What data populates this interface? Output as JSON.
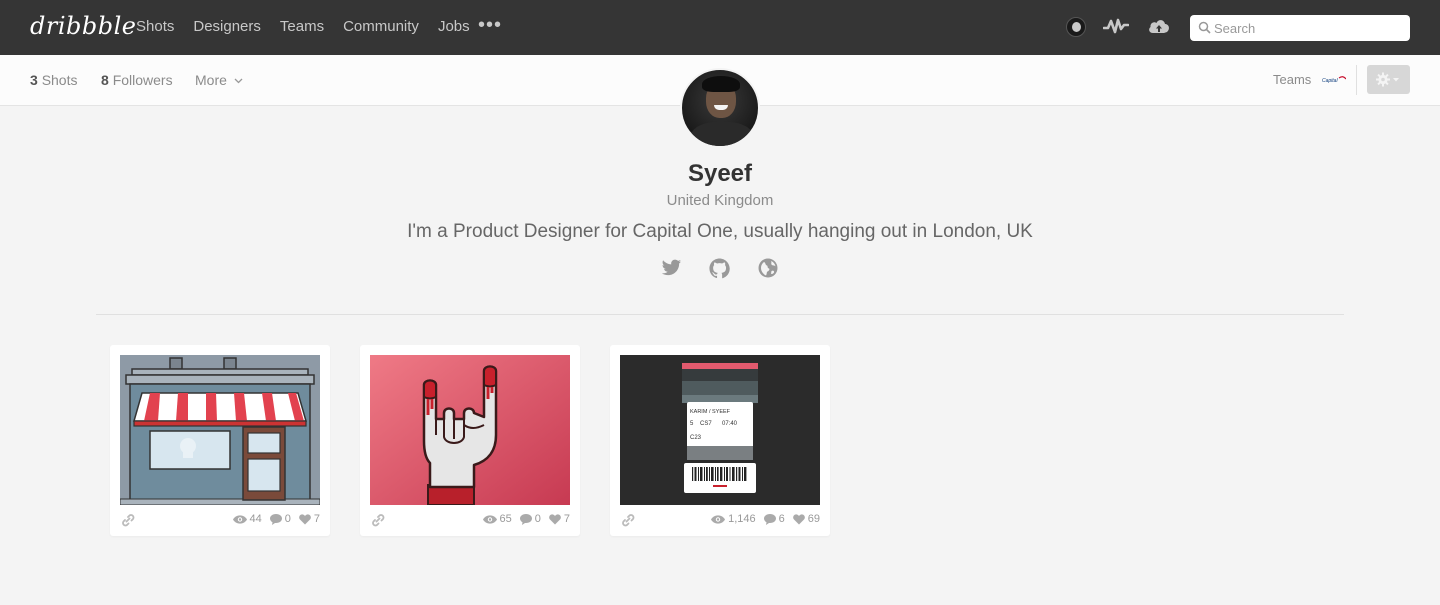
{
  "nav": {
    "logo": "dribbble",
    "links": [
      "Shots",
      "Designers",
      "Teams",
      "Community",
      "Jobs"
    ],
    "more": "•••",
    "search_placeholder": "Search"
  },
  "subbar": {
    "shots_count": "3",
    "shots_label": "Shots",
    "followers_count": "8",
    "followers_label": "Followers",
    "more_label": "More",
    "teams_label": "Teams",
    "team_logo_text": "Capital One"
  },
  "profile": {
    "name": "Syeef",
    "location": "United Kingdom",
    "bio": "I'm a Product Designer for Capital One, usually hanging out in London, UK",
    "social_icons": [
      "twitter-icon",
      "github-icon",
      "globe-icon"
    ]
  },
  "shots": [
    {
      "views": "44",
      "comments": "0",
      "likes": "7",
      "subject": "shop-front"
    },
    {
      "views": "65",
      "comments": "0",
      "likes": "7",
      "subject": "rock-hand"
    },
    {
      "views": "1,146",
      "comments": "6",
      "likes": "69",
      "subject": "boarding-pass",
      "ticket": {
        "names": "KARIM / SYEEF",
        "seat": "5",
        "flight": "CS7",
        "time": "07:40",
        "gate": "C23"
      }
    }
  ],
  "colors": {
    "nav_bg": "#353535",
    "accent_red": "#ea4c89",
    "shot_pink": "#e25a6e"
  }
}
